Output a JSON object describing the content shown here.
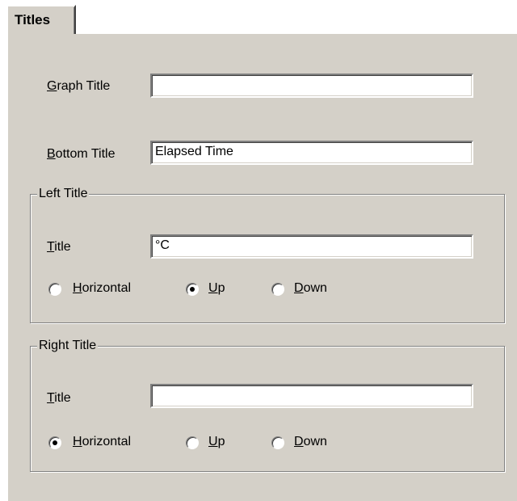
{
  "tab": {
    "label": "Titles"
  },
  "graph_title": {
    "label_mnemonic": "G",
    "label_rest": "raph Title",
    "value": ""
  },
  "bottom_title": {
    "label_mnemonic": "B",
    "label_rest": "ottom Title",
    "value": "Elapsed Time"
  },
  "left_title": {
    "group_label": "Left Title",
    "title_mnemonic": "T",
    "title_rest": "itle",
    "value": "°C",
    "options": [
      {
        "mnemonic": "H",
        "rest": "orizontal",
        "checked": false
      },
      {
        "mnemonic": "U",
        "rest": "p",
        "checked": true
      },
      {
        "mnemonic": "D",
        "rest": "own",
        "checked": false
      }
    ]
  },
  "right_title": {
    "group_label": "Right Title",
    "title_mnemonic": "T",
    "title_rest": "itle",
    "value": "",
    "options": [
      {
        "mnemonic": "H",
        "rest": "orizontal",
        "checked": true
      },
      {
        "mnemonic": "U",
        "rest": "p",
        "checked": false
      },
      {
        "mnemonic": "D",
        "rest": "own",
        "checked": false
      }
    ]
  },
  "colors": {
    "dialog_face": "#d4d0c8",
    "field_bg": "#ffffff"
  }
}
